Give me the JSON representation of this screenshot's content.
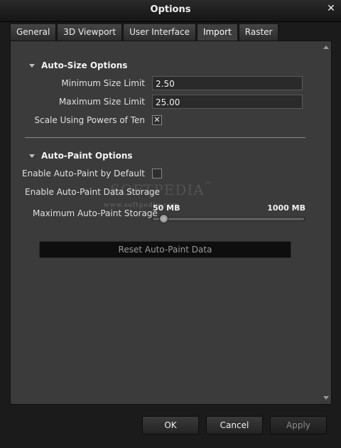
{
  "window": {
    "title": "Options"
  },
  "tabs": [
    {
      "label": "General"
    },
    {
      "label": "3D Viewport"
    },
    {
      "label": "User Interface"
    },
    {
      "label": "Import"
    },
    {
      "label": "Raster"
    }
  ],
  "active_tab": "Import",
  "auto_size": {
    "heading": "Auto-Size Options",
    "min_label": "Minimum Size Limit",
    "min_value": "2.50",
    "max_label": "Maximum Size Limit",
    "max_value": "25.00",
    "scale_label": "Scale Using Powers of Ten",
    "scale_checked": true,
    "check_glyph": "✕"
  },
  "auto_paint": {
    "heading": "Auto-Paint Options",
    "enable_label": "Enable Auto-Paint by Default",
    "enable_checked": false,
    "storage_label": "Enable Auto-Paint Data Storage",
    "max_storage_label": "Maximum Auto-Paint Storage",
    "slider_min": "50 MB",
    "slider_max": "1000 MB",
    "slider_fraction": 0.0,
    "reset_label": "Reset Auto-Paint Data"
  },
  "watermark": {
    "brand": "SOFTPEDIA",
    "tm": "™",
    "url": "www.softpedia.com"
  },
  "buttons": {
    "ok": "OK",
    "cancel": "Cancel",
    "apply": "Apply"
  },
  "icons": {
    "close": "close-icon",
    "expand": "collapse-triangle-icon"
  }
}
